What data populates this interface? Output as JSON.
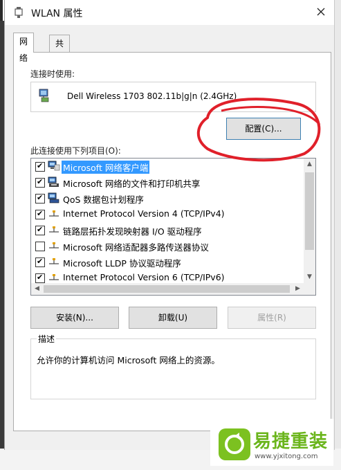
{
  "window": {
    "title": "WLAN 属性"
  },
  "tabs": [
    {
      "label": "网络"
    },
    {
      "label": "共享"
    }
  ],
  "connect_using": {
    "label": "连接时使用:",
    "adapter": "Dell Wireless 1703 802.11b|g|n (2.4GHz)",
    "configure_button": "配置(C)..."
  },
  "items_section": {
    "label": "此连接使用下列项目(O):",
    "items": [
      {
        "label": "Microsoft 网络客户端",
        "checked": "✔",
        "icon": "network-client-icon",
        "selected": true
      },
      {
        "label": "Microsoft 网络的文件和打印机共享",
        "checked": "✔",
        "icon": "file-printer-sharing-icon"
      },
      {
        "label": "QoS 数据包计划程序",
        "checked": "✔",
        "icon": "qos-icon"
      },
      {
        "label": "Internet Protocol Version 4 (TCP/IPv4)",
        "checked": "✔",
        "icon": "protocol-icon"
      },
      {
        "label": "链路层拓扑发现映射器 I/O 驱动程序",
        "checked": "✔",
        "icon": "protocol-icon"
      },
      {
        "label": "Microsoft 网络适配器多路传送器协议",
        "checked": "",
        "icon": "protocol-icon"
      },
      {
        "label": "Microsoft LLDP 协议驱动程序",
        "checked": "✔",
        "icon": "protocol-icon"
      },
      {
        "label": "Internet Protocol Version 6 (TCP/IPv6)",
        "checked": "✔",
        "icon": "protocol-icon"
      }
    ]
  },
  "buttons": {
    "install": "安装(N)...",
    "uninstall": "卸载(U)",
    "properties": "属性(R)"
  },
  "description": {
    "title": "描述",
    "text": "允许你的计算机访问 Microsoft 网络上的资源。"
  },
  "watermark": {
    "name": "易捷重装",
    "url": "www.yjxitong.com"
  },
  "colors": {
    "selection": "#3399ff",
    "annotation_red": "#e0202a",
    "logo_green": "#7cc120"
  }
}
